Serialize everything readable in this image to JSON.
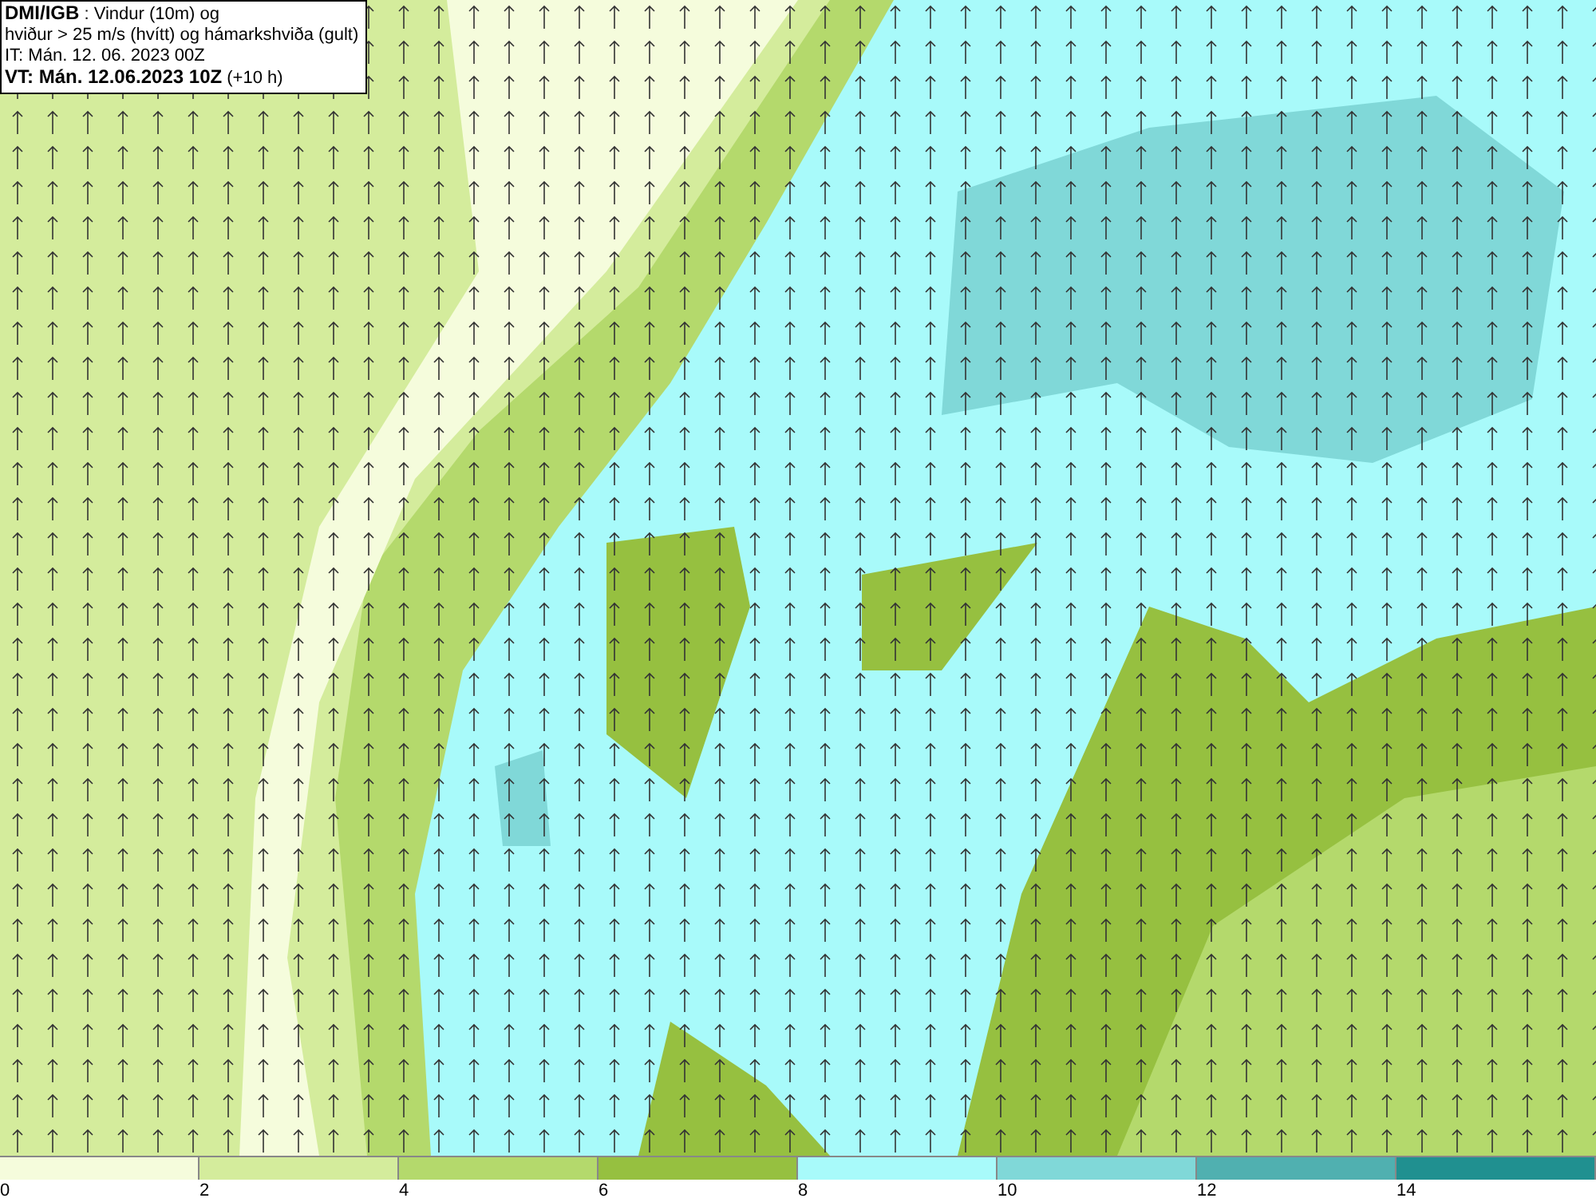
{
  "header": {
    "lines": [
      "**DMI/IGB** : Vindur (10m) og",
      "hviður > 25 m/s (hvítt) og hámarkshviða (gult)",
      "IT: Mán. 12. 06. 2023 00Z",
      "**VT: Mán. 12.06.2023 10Z** (+10 h)"
    ]
  },
  "legend": {
    "segments": [
      {
        "label": "0",
        "color": "#f5fcdc"
      },
      {
        "label": "2",
        "color": "#d4ec9c"
      },
      {
        "label": "4",
        "color": "#b4d96c"
      },
      {
        "label": "6",
        "color": "#96c040"
      },
      {
        "label": "8",
        "color": "#a8fafa"
      },
      {
        "label": "10",
        "color": "#80d8d8"
      },
      {
        "label": "12",
        "color": "#50b0b0"
      },
      {
        "label": "14",
        "color": "#209090"
      }
    ]
  }
}
